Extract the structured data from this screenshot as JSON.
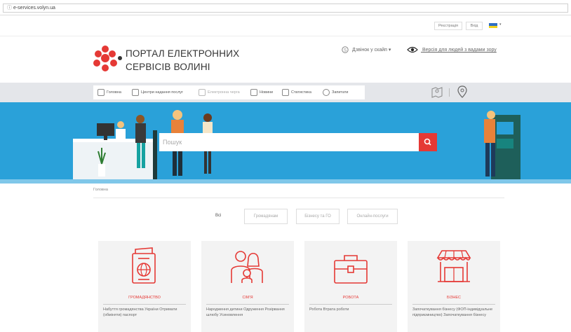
{
  "browser": {
    "url": "e-services.volyn.ua"
  },
  "topbar": {
    "register": "Реєстрація",
    "login": "Вхід",
    "flag_colors": [
      "#2f6fc4",
      "#f2d21a"
    ]
  },
  "brand": {
    "line1": "ПОРТАЛ ЕЛЕКТРОННИХ",
    "line2": "СЕРВІСІВ ВОЛИНІ",
    "logo_color": "#e53935"
  },
  "header": {
    "skype": "Дзвінок у скайп ▾",
    "accessibility": "Версія для людей з вадами зору"
  },
  "nav": {
    "items": [
      {
        "label": "Головна"
      },
      {
        "label": "Центри надання послуг"
      },
      {
        "label": "Електронна черга"
      },
      {
        "label": "Новини"
      },
      {
        "label": "Статистика"
      },
      {
        "label": "Запитати"
      }
    ]
  },
  "search": {
    "placeholder": "Пошук"
  },
  "breadcrumb": "Головна",
  "filters": {
    "all": "Всі",
    "items": [
      "Громадянам",
      "Бізнесу та ГО",
      "Онлайн-послуги"
    ]
  },
  "cards": [
    {
      "title": "ГРОМАДЯНСТВО",
      "body": "Набуття громадянства України Отримати (обміняти) паспорт"
    },
    {
      "title": "СІМ'Я",
      "body": "Народження дитини Одруження Розірвання шлюбу Усиновлення"
    },
    {
      "title": "РОБОТА",
      "body": "Робота Втрата роботи"
    },
    {
      "title": "БІЗНЕС",
      "body": "Започаткування бізнесу (ФОП-індивідуальне підприємництво) Започаткування бізнесу"
    }
  ],
  "colors": {
    "accent": "#e53935",
    "hero": "#2aa1d9"
  }
}
